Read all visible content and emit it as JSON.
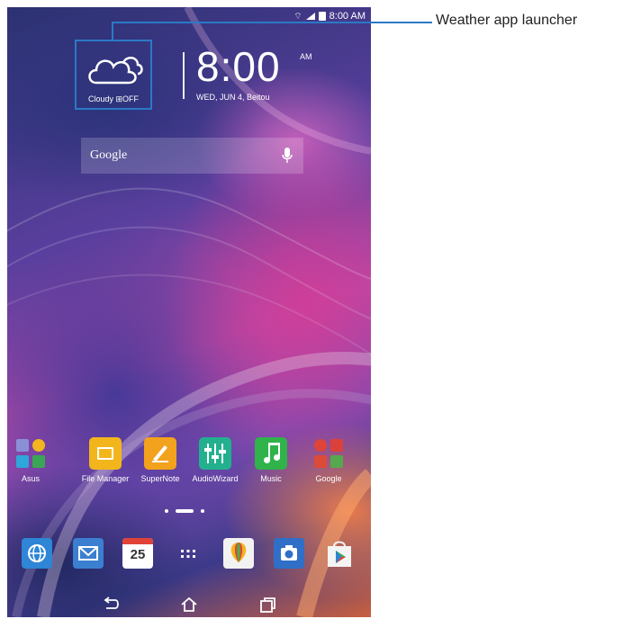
{
  "status_bar": {
    "time": "8:00 AM"
  },
  "weather_widget": {
    "condition": "Cloudy",
    "mode": "OFF"
  },
  "clock": {
    "time": "8:00",
    "ampm": "AM",
    "date": "WED, JUN 4, Beitou"
  },
  "search": {
    "label": "Google"
  },
  "apps": [
    {
      "label": "Asus"
    },
    {
      "label": "File Manager"
    },
    {
      "label": "SuperNote"
    },
    {
      "label": "AudioWizard"
    },
    {
      "label": "Music"
    },
    {
      "label": "Google"
    }
  ],
  "dock": {
    "calendar_day": "25"
  },
  "callout": {
    "label": "Weather app launcher",
    "color": "#2b79c7"
  }
}
